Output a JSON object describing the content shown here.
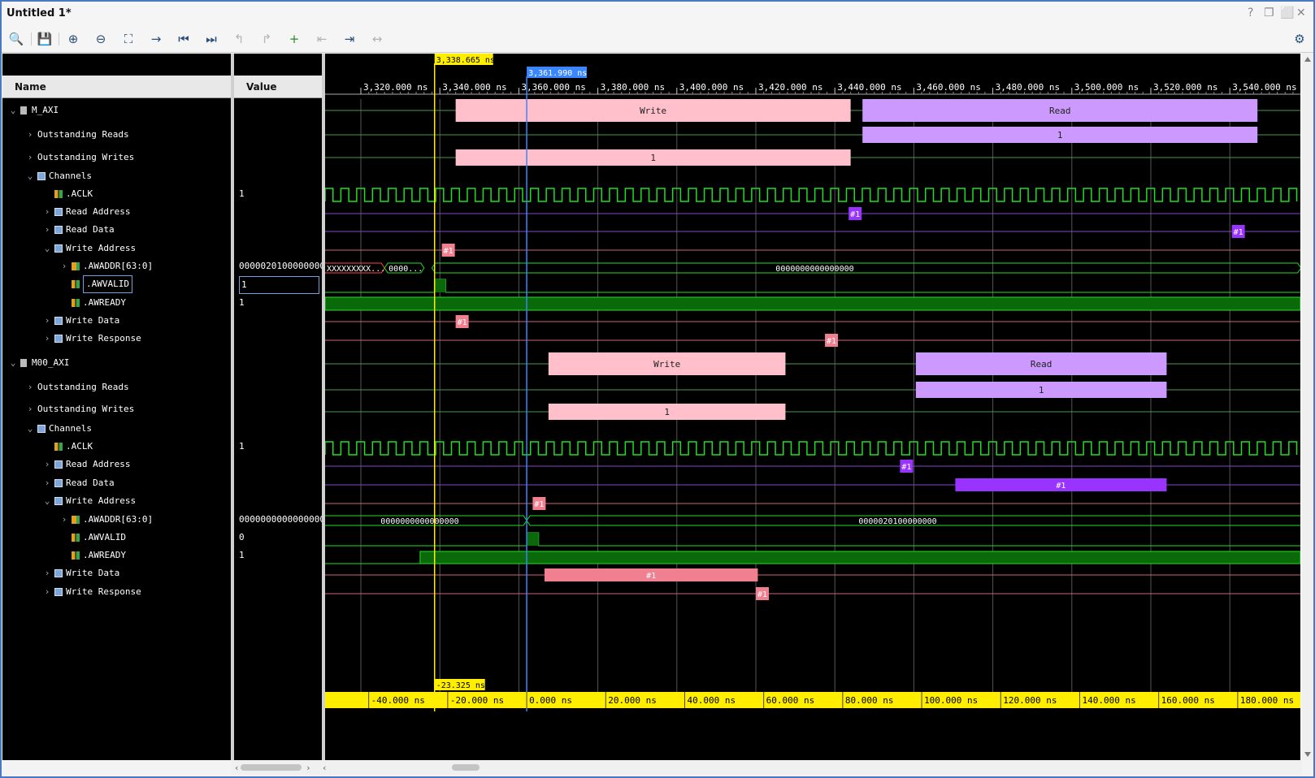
{
  "window": {
    "title": "Untitled 1*",
    "controls": [
      "?",
      "❐",
      "⬜",
      "✕"
    ]
  },
  "toolbar": {
    "buttons": [
      {
        "name": "search",
        "glyph": "🔍"
      },
      {
        "name": "save",
        "glyph": "💾"
      },
      {
        "name": "zoom-in",
        "glyph": "⊕"
      },
      {
        "name": "zoom-out",
        "glyph": "⊖"
      },
      {
        "name": "zoom-fit",
        "glyph": "⛶"
      },
      {
        "name": "go-to-cursor",
        "glyph": "→"
      },
      {
        "name": "go-to-time-zero",
        "glyph": "⏮"
      },
      {
        "name": "go-to-last-time",
        "glyph": "⏭"
      },
      {
        "name": "previous-transition",
        "glyph": "↰"
      },
      {
        "name": "next-transition",
        "glyph": "↱"
      },
      {
        "name": "add-marker",
        "glyph": "+"
      },
      {
        "name": "previous-marker",
        "glyph": "⇤"
      },
      {
        "name": "next-marker",
        "glyph": "⇥"
      },
      {
        "name": "swap-cursors",
        "glyph": "↔"
      }
    ],
    "settings_glyph": "⚙"
  },
  "columns": {
    "name": "Name",
    "value": "Value"
  },
  "rows": [
    {
      "label": "M_AXI",
      "value": ""
    },
    {
      "label": "Outstanding Reads",
      "value": ""
    },
    {
      "label": "Outstanding Writes",
      "value": ""
    },
    {
      "label": "Channels",
      "value": ""
    },
    {
      "label": ".ACLK",
      "value": "1"
    },
    {
      "label": "Read Address",
      "value": ""
    },
    {
      "label": "Read Data",
      "value": ""
    },
    {
      "label": "Write Address",
      "value": ""
    },
    {
      "label": ".AWADDR[63:0]",
      "value": "0000020100000000"
    },
    {
      "label": ".AWVALID",
      "value": "1"
    },
    {
      "label": ".AWREADY",
      "value": "1"
    },
    {
      "label": "Write Data",
      "value": ""
    },
    {
      "label": "Write Response",
      "value": ""
    },
    {
      "label": "M00_AXI",
      "value": ""
    },
    {
      "label": "Outstanding Reads",
      "value": ""
    },
    {
      "label": "Outstanding Writes",
      "value": ""
    },
    {
      "label": "Channels",
      "value": ""
    },
    {
      "label": ".ACLK",
      "value": "1"
    },
    {
      "label": "Read Address",
      "value": ""
    },
    {
      "label": "Read Data",
      "value": ""
    },
    {
      "label": "Write Address",
      "value": ""
    },
    {
      "label": ".AWADDR[63:0]",
      "value": "0000000000000000"
    },
    {
      "label": ".AWVALID",
      "value": "0"
    },
    {
      "label": ".AWREADY",
      "value": "1"
    },
    {
      "label": "Write Data",
      "value": ""
    },
    {
      "label": "Write Response",
      "value": ""
    }
  ],
  "cursors": {
    "yellow_label": "3,338.665 ns",
    "blue_label": "3,361.990 ns",
    "delta_label": "-23.325 ns"
  },
  "timeline": {
    "top_ticks": [
      "3,320.000 ns",
      "3,340.000 ns",
      "3,360.000 ns",
      "3,380.000 ns",
      "3,400.000 ns",
      "3,420.000 ns",
      "3,440.000 ns",
      "3,460.000 ns",
      "3,480.000 ns",
      "3,500.000 ns",
      "3,520.000 ns",
      "3,540.000 ns"
    ],
    "bottom_ticks": [
      "-40.000 ns",
      "-20.000 ns",
      "0.000 ns",
      "20.000 ns",
      "40.000 ns",
      "60.000 ns",
      "80.000 ns",
      "100.000 ns",
      "120.000 ns",
      "140.000 ns",
      "160.000 ns",
      "180.000 ns"
    ]
  },
  "wave_labels": {
    "write": "Write",
    "read": "Read",
    "one": "1",
    "marker": "#1",
    "m_awaddr_a": "XXXXXXXXX...",
    "m_awaddr_b": "0000...",
    "m_awaddr_c": "0000000000000000",
    "s_awaddr_a": "0000000000000000",
    "s_awaddr_b": "0000020100000000"
  },
  "colors": {
    "write": "#ffc0cb",
    "read": "#cc99ff",
    "marker_write": "#f08090",
    "marker_read": "#9933ff",
    "clock": "#22dd22",
    "cursor_yellow": "#ffee00",
    "cursor_blue": "#3a86ff"
  }
}
